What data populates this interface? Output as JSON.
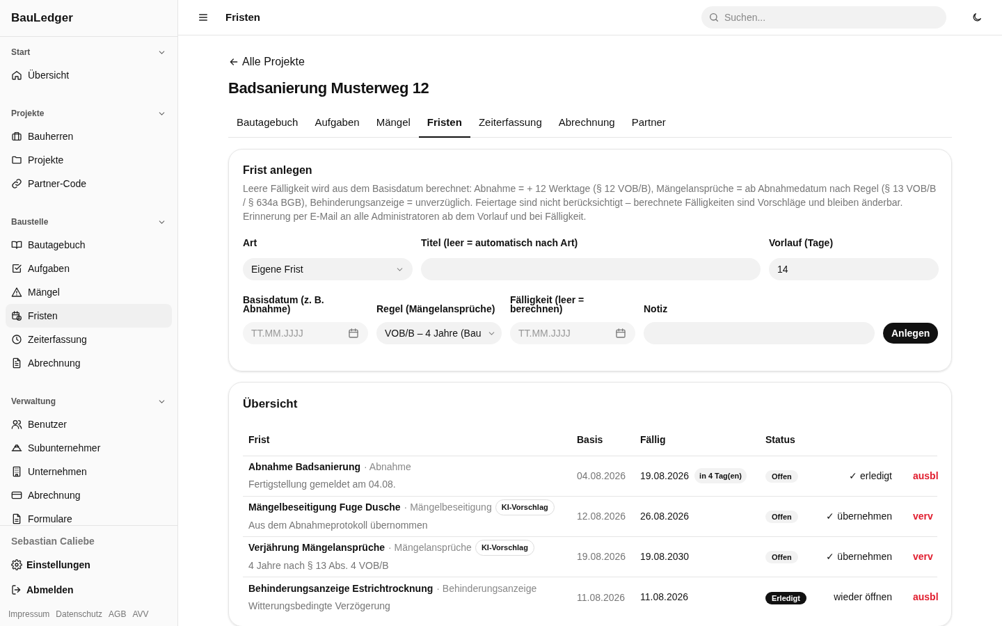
{
  "app": {
    "name": "BauLedger"
  },
  "sidebar": {
    "sections": [
      {
        "title": "Start",
        "expanded": true,
        "items": [
          {
            "label": "Übersicht",
            "selected": false
          }
        ]
      },
      {
        "title": "Projekte",
        "expanded": true,
        "items": [
          {
            "label": "Bauherren",
            "selected": false
          },
          {
            "label": "Projekte",
            "selected": false
          },
          {
            "label": "Partner-Code",
            "selected": false
          }
        ]
      },
      {
        "title": "Baustelle",
        "expanded": true,
        "items": [
          {
            "label": "Bautagebuch",
            "selected": false
          },
          {
            "label": "Aufgaben",
            "selected": false
          },
          {
            "label": "Mängel",
            "selected": false
          },
          {
            "label": "Fristen",
            "selected": true
          },
          {
            "label": "Zeiterfassung",
            "selected": false
          },
          {
            "label": "Abrechnung",
            "selected": false
          }
        ]
      },
      {
        "title": "Verwaltung",
        "expanded": true,
        "items": [
          {
            "label": "Benutzer",
            "selected": false
          },
          {
            "label": "Subunternehmer",
            "selected": false
          },
          {
            "label": "Unternehmen",
            "selected": false
          },
          {
            "label": "Abrechnung",
            "selected": false
          },
          {
            "label": "Formulare",
            "selected": false
          }
        ]
      }
    ],
    "user": "Sebastian Caliebe",
    "actions": [
      "Einstellungen",
      "Abmelden"
    ],
    "footer_links": [
      "Impressum",
      "Datenschutz",
      "AGB",
      "AVV"
    ]
  },
  "header": {
    "title": "Fristen",
    "search": {
      "placeholder": "Suchen..."
    }
  },
  "back_link": "Alle Projekte",
  "project_title": "Badsanierung Musterweg 12",
  "tabs": [
    {
      "label": "Bautagebuch",
      "selected": false
    },
    {
      "label": "Aufgaben",
      "selected": false
    },
    {
      "label": "Mängel",
      "selected": false
    },
    {
      "label": "Fristen",
      "selected": true
    },
    {
      "label": "Zeiterfassung",
      "selected": false
    },
    {
      "label": "Abrechnung",
      "selected": false
    },
    {
      "label": "Partner",
      "selected": false
    }
  ],
  "form": {
    "title": "Frist anlegen",
    "description": "Leere Fälligkeit wird aus dem Basisdatum berechnet: Abnahme = + 12 Werktage (§ 12 VOB/B), Mängelansprüche = ab Abnahmedatum nach Regel (§ 13 VOB/B / § 634a BGB), Behinderungsanzeige = unverzüglich. Feiertage sind nicht berücksichtigt – berechnete Fälligkeiten sind Vorschläge und bleiben änderbar. Erinnerung per E-Mail an alle Administratoren ab dem Vorlauf und bei Fälligkeit.",
    "row_1": [
      {
        "kind": "select",
        "label": "Art",
        "value": "Eigene Frist"
      },
      {
        "kind": "text",
        "label": "Titel (leer = automatisch nach Art)"
      },
      {
        "kind": "text",
        "label": "Vorlauf (Tage)",
        "value": "14"
      }
    ],
    "row_2": [
      {
        "kind": "date",
        "label": "Basisdatum (z. B. Abnahme)",
        "placeholder": "TT.MM.JJJJ"
      },
      {
        "kind": "select",
        "label": "Regel (Mängelansprüche)",
        "value": "VOB/B – 4 Jahre (Bau"
      },
      {
        "kind": "date",
        "label": "Fälligkeit (leer = berechnen)",
        "placeholder": "TT.MM.JJJJ"
      },
      {
        "kind": "text",
        "label": "Notiz"
      }
    ],
    "submit": "Anlegen"
  },
  "overview": {
    "title": "Übersicht",
    "table": {
      "columns": [
        "Frist",
        "Basis",
        "Fällig",
        "Status"
      ],
      "rows": [
        {
          "title": "Abnahme Badsanierung",
          "type": "· Abnahme",
          "note": "Fertigstellung gemeldet am 04.08.",
          "basis": "04.08.2026",
          "due": "19.08.2026",
          "due_hint": "in 4 Tag(en)",
          "status": "Offen",
          "done": false,
          "action": "✓ erledigt",
          "danger_action": "ausbl"
        },
        {
          "title": "Mängelbeseitigung Fuge Dusche",
          "type": "· Mängelbeseitigung",
          "tag": "KI-Vorschlag",
          "note": "Aus dem Abnahmeprotokoll übernommen",
          "basis": "12.08.2026",
          "due": "26.08.2026",
          "status": "Offen",
          "done": false,
          "action": "✓ übernehmen",
          "danger_action": "verv"
        },
        {
          "title": "Verjährung Mängelansprüche",
          "type": "· Mängelansprüche",
          "tag": "KI-Vorschlag",
          "note": "4 Jahre nach § 13 Abs. 4 VOB/B",
          "basis": "19.08.2026",
          "due": "19.08.2030",
          "status": "Offen",
          "done": false,
          "action": "✓ übernehmen",
          "danger_action": "verv"
        },
        {
          "title": "Behinderungsanzeige Estrichtrocknung",
          "type": "· Behinderungsanzeige",
          "note": "Witterungsbedingte Verzögerung",
          "basis": "11.08.2026",
          "due": "11.08.2026",
          "status": "Erledigt",
          "done": true,
          "action": "wieder öffnen",
          "danger_action": "ausbl"
        }
      ]
    }
  }
}
